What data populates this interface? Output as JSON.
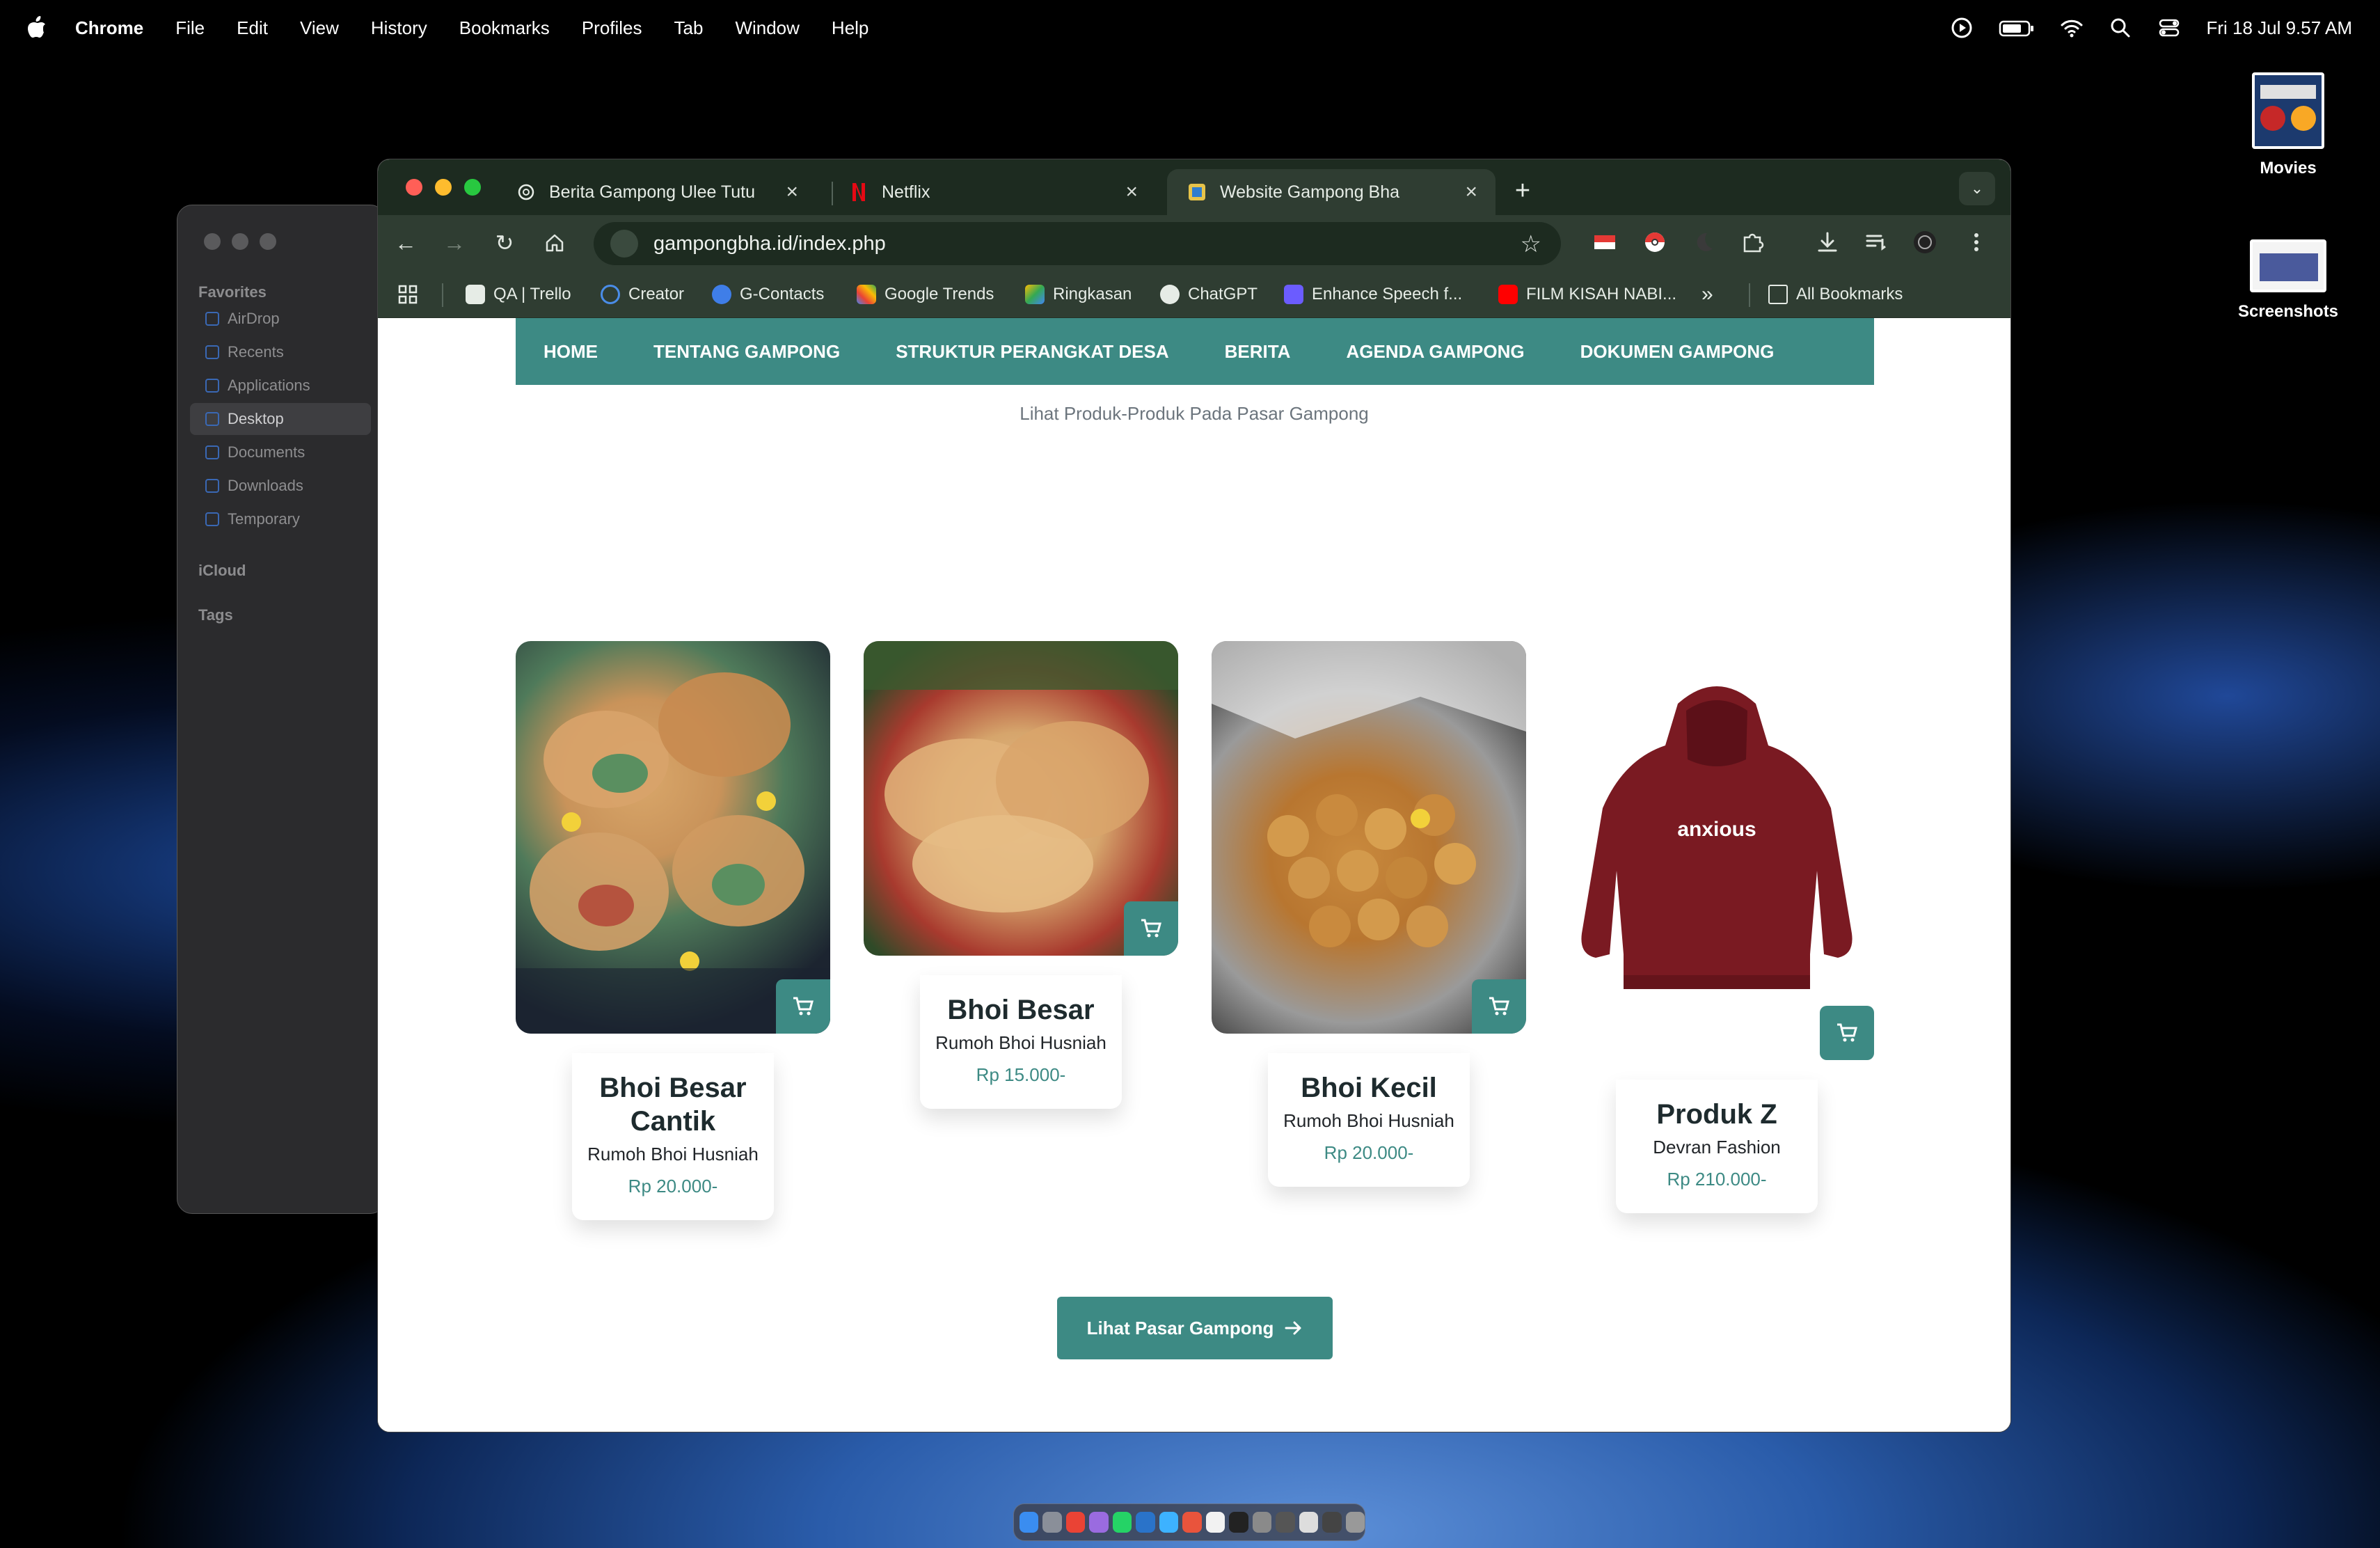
{
  "menubar": {
    "app": "Chrome",
    "menus": [
      "File",
      "Edit",
      "View",
      "History",
      "Bookmarks",
      "Profiles",
      "Tab",
      "Window",
      "Help"
    ],
    "clock": "Fri 18 Jul  9.57 AM"
  },
  "desktop_icons": [
    {
      "label": "Movies"
    },
    {
      "label": "Screenshots"
    }
  ],
  "finder": {
    "favorites_header": "Favorites",
    "items": [
      "AirDrop",
      "Recents",
      "Applications",
      "Desktop",
      "Documents",
      "Downloads",
      "Temporary"
    ],
    "selected": "Desktop",
    "icloud": "iCloud",
    "tags": "Tags"
  },
  "browser": {
    "tabs": [
      {
        "title": "Berita Gampong Ulee Tutu",
        "active": false
      },
      {
        "title": "Netflix",
        "active": false
      },
      {
        "title": "Website Gampong Bha",
        "active": true
      }
    ],
    "url": "gampongbha.id/index.php",
    "bookmarks": [
      "QA | Trello",
      "Creator",
      "G-Contacts",
      "Google Trends",
      "Ringkasan",
      "ChatGPT",
      "Enhance Speech f...",
      "FILM KISAH NABI..."
    ],
    "all_bookmarks": "All Bookmarks",
    "overflow": "»"
  },
  "site": {
    "nav": [
      "HOME",
      "TENTANG GAMPONG",
      "STRUKTUR PERANGKAT DESA",
      "BERITA",
      "AGENDA GAMPONG",
      "DOKUMEN GAMPONG"
    ],
    "subtitle": "Lihat Produk-Produk Pada Pasar Gampong",
    "products": [
      {
        "name": "Bhoi Besar Cantik",
        "seller": "Rumoh Bhoi Husniah",
        "price": "Rp 20.000-"
      },
      {
        "name": "Bhoi Besar",
        "seller": "Rumoh Bhoi Husniah",
        "price": "Rp 15.000-"
      },
      {
        "name": "Bhoi Kecil",
        "seller": "Rumoh Bhoi Husniah",
        "price": "Rp 20.000-"
      },
      {
        "name": "Produk Z",
        "seller": "Devran Fashion",
        "price": "Rp 210.000-"
      }
    ],
    "hoodie_text": "anxious",
    "cta": "Lihat Pasar Gampong"
  },
  "colors": {
    "accent": "#3d8a84",
    "tabstrip": "#1d2b20",
    "toolbar": "#2f3d32"
  }
}
